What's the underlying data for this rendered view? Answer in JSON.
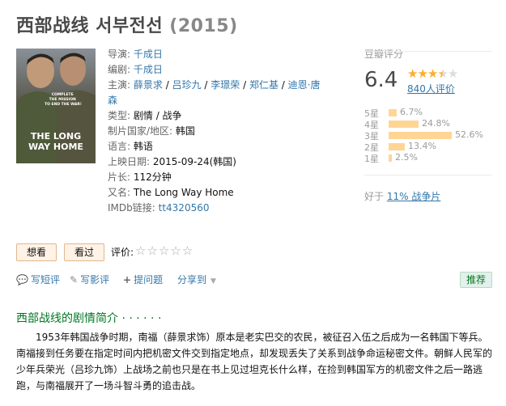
{
  "header": {
    "title": "西部战线 서부전선",
    "year": "(2015)"
  },
  "poster": {
    "tagline": [
      "COMPLETE",
      "THE MISSION",
      "TO END THE WAR!"
    ],
    "film_title_line1": "THE LONG",
    "film_title_line2": "WAY HOME"
  },
  "info": {
    "director_label": "导演:",
    "director": "千成日",
    "writer_label": "编剧:",
    "writer": "千成日",
    "cast_label": "主演:",
    "cast": [
      "薛景求",
      "吕珍九",
      "李璟荣",
      "郑仁基",
      "迪恩·唐森"
    ],
    "cast_sep": " / ",
    "genre_label": "类型:",
    "genre": "剧情 / 战争",
    "country_label": "制片国家/地区:",
    "country": "韩国",
    "language_label": "语言:",
    "language": "韩语",
    "release_label": "上映日期:",
    "release": "2015-09-24(韩国)",
    "runtime_label": "片长:",
    "runtime": "112分钟",
    "aka_label": "又名:",
    "aka": "The Long Way Home",
    "imdb_label": "IMDb链接:",
    "imdb": "tt4320560"
  },
  "rating": {
    "label": "豆瓣评分",
    "score": "6.4",
    "stars_filled": 3.5,
    "votes": "840人评价",
    "distribution": [
      {
        "star": "5星",
        "pct": "6.7%",
        "value": 6.7
      },
      {
        "star": "4星",
        "pct": "24.8%",
        "value": 24.8
      },
      {
        "star": "3星",
        "pct": "52.6%",
        "value": 52.6
      },
      {
        "star": "2星",
        "pct": "13.4%",
        "value": 13.4
      },
      {
        "star": "1星",
        "pct": "2.5%",
        "value": 2.5
      }
    ],
    "better_prefix": "好于 ",
    "better_link": "11% 战争片"
  },
  "actions": {
    "want": "想看",
    "seen": "看过",
    "rate_label": "评价:",
    "rate_stars": "☆☆☆☆☆"
  },
  "ops": {
    "short_review": "写短评",
    "review": "写影评",
    "ask": "提问题",
    "share": "分享到",
    "recommend": "推荐"
  },
  "synopsis": {
    "title": "西部战线的剧情简介 · · · · · ·",
    "text": "1953年韩国战争时期，南福（薛景求饰）原本是老实巴交的农民，被征召入伍之后成为一名韩国下等兵。南福接到任务要在指定时间内把机密文件交到指定地点，却发现丢失了关系到战争命运秘密文件。朝鲜人民军的少年兵荣光（吕珍九饰）上战场之前也只是在书上见过坦克长什么样，在捡到韩国军方的机密文件之后一路逃跑，与南福展开了一场斗智斗勇的追击战。"
  }
}
